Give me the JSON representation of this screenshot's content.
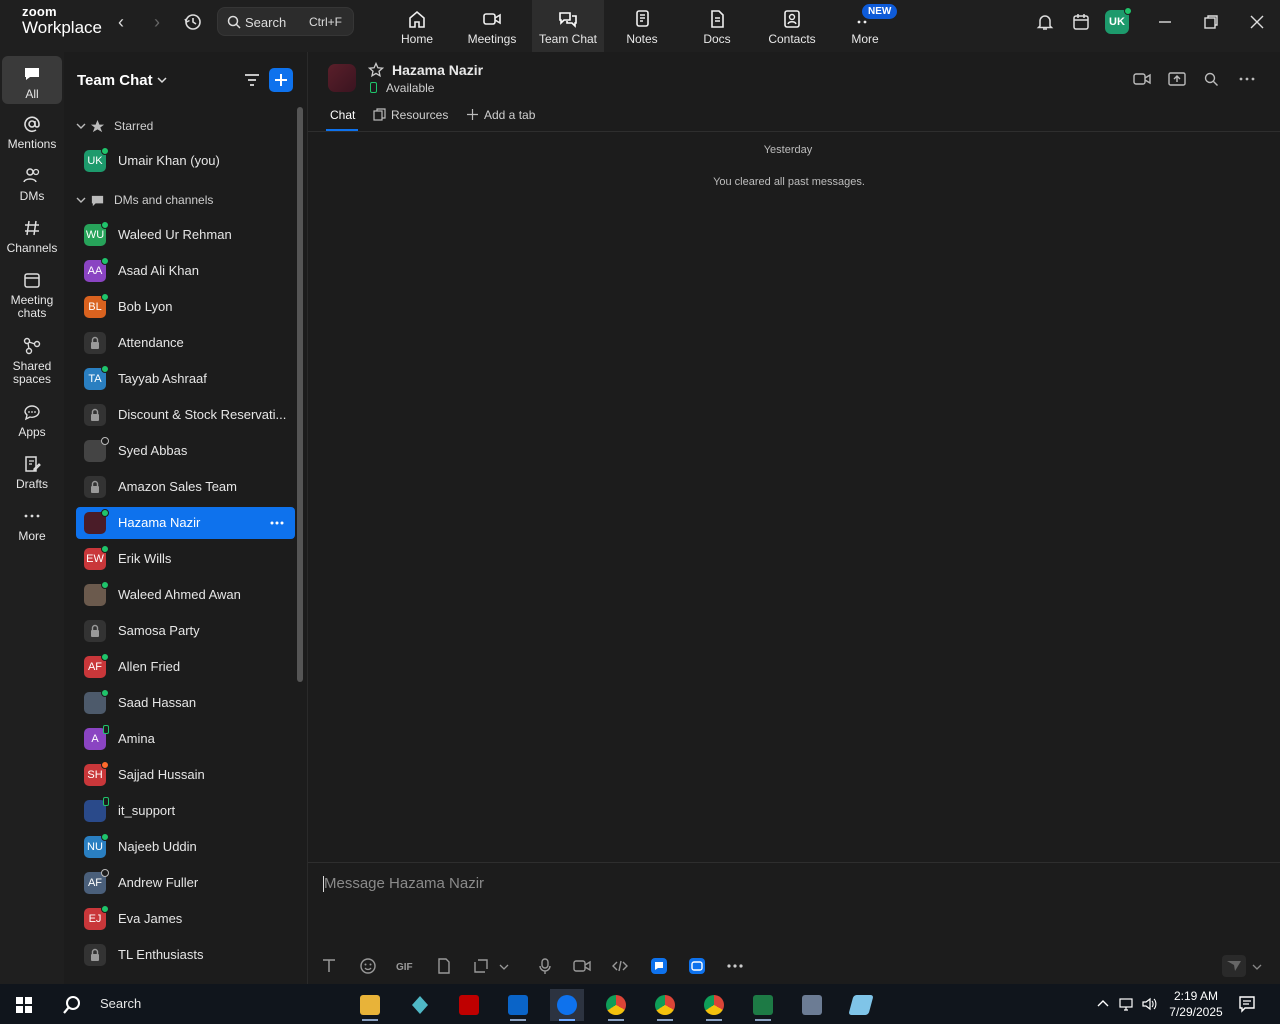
{
  "app": {
    "brand_line1": "zoom",
    "brand_line2": "Workplace"
  },
  "search": {
    "placeholder": "Search",
    "shortcut": "Ctrl+F"
  },
  "top_tabs": [
    {
      "label": "Home",
      "icon": "home-icon"
    },
    {
      "label": "Meetings",
      "icon": "video-camera-icon"
    },
    {
      "label": "Team Chat",
      "icon": "chat-bubbles-icon",
      "active": true
    },
    {
      "label": "Notes",
      "icon": "notes-icon"
    },
    {
      "label": "Docs",
      "icon": "docs-icon"
    },
    {
      "label": "Contacts",
      "icon": "contacts-icon"
    },
    {
      "label": "More",
      "icon": "more-dots-icon"
    }
  ],
  "new_badge": "NEW",
  "user_initials": "UK",
  "rail": [
    {
      "label": "All",
      "icon": "chat-icon",
      "active": true
    },
    {
      "label": "Mentions",
      "icon": "at-icon"
    },
    {
      "label": "DMs",
      "icon": "people-icon"
    },
    {
      "label": "Channels",
      "icon": "hash-icon"
    },
    {
      "label": "Meeting chats",
      "icon": "calendar-icon"
    },
    {
      "label": "Shared spaces",
      "icon": "shared-spaces-icon"
    },
    {
      "label": "Apps",
      "icon": "apps-icon"
    },
    {
      "label": "Drafts",
      "icon": "drafts-icon"
    },
    {
      "label": "More",
      "icon": "ellipsis-icon"
    }
  ],
  "sidebar": {
    "title": "Team Chat",
    "starred_label": "Starred",
    "starred": [
      {
        "name": "Umair Khan (you)",
        "initials": "UK",
        "color": "#1d9a6c",
        "presence": "online"
      }
    ],
    "dms_label": "DMs and channels",
    "items": [
      {
        "name": "Waleed Ur Rehman",
        "initials": "WU",
        "color": "#27a35a",
        "presence": "online"
      },
      {
        "name": "Asad Ali Khan",
        "initials": "AA",
        "color": "#8a44c2",
        "presence": "online"
      },
      {
        "name": "Bob Lyon",
        "initials": "BL",
        "color": "#d9621f",
        "presence": "online"
      },
      {
        "name": "Attendance",
        "type": "channel"
      },
      {
        "name": "Tayyab Ashraaf",
        "initials": "TA",
        "color": "#2a7fc1",
        "presence": "online"
      },
      {
        "name": "Discount & Stock Reservati...",
        "type": "channel"
      },
      {
        "name": "Syed Abbas",
        "initials": "",
        "color": "#444444",
        "presence": "away",
        "photo": true
      },
      {
        "name": "Amazon Sales Team",
        "type": "channel"
      },
      {
        "name": "Hazama Nazir",
        "initials": "",
        "color": "#4a1c28",
        "presence": "online",
        "active": true
      },
      {
        "name": "Erik Wills",
        "initials": "EW",
        "color": "#c9373a",
        "presence": "online"
      },
      {
        "name": "Waleed Ahmed Awan",
        "initials": "",
        "color": "#6b5a4d",
        "presence": "online",
        "photo": true
      },
      {
        "name": "Samosa Party",
        "type": "channel"
      },
      {
        "name": "Allen Fried",
        "initials": "AF",
        "color": "#c9373a",
        "presence": "online"
      },
      {
        "name": "Saad Hassan",
        "initials": "",
        "color": "#4d5a6b",
        "presence": "online",
        "photo": true
      },
      {
        "name": "Amina",
        "initials": "A",
        "color": "#8a44c2",
        "presence": "mobile"
      },
      {
        "name": "Sajjad Hussain",
        "initials": "SH",
        "color": "#c9373a",
        "presence": "busy"
      },
      {
        "name": "it_support",
        "initials": "",
        "color": "#2a4a8a",
        "presence": "mobile",
        "photo": true
      },
      {
        "name": "Najeeb Uddin",
        "initials": "NU",
        "color": "#2a7fc1",
        "presence": "online"
      },
      {
        "name": "Andrew Fuller",
        "initials": "AF",
        "color": "#4a5f7a",
        "presence": "away"
      },
      {
        "name": "Eva James",
        "initials": "EJ",
        "color": "#c9373a",
        "presence": "online"
      },
      {
        "name": "TL Enthusiasts",
        "type": "channel"
      }
    ]
  },
  "chat": {
    "contact_name": "Hazama Nazir",
    "status": "Available",
    "tabs": [
      {
        "label": "Chat",
        "active": true
      },
      {
        "label": "Resources"
      },
      {
        "label": "Add a tab"
      }
    ],
    "date_divider": "Yesterday",
    "system_message": "You cleared all past messages.",
    "composer_placeholder": "Message Hazama Nazir",
    "toolbar": [
      {
        "icon": "text-format-icon"
      },
      {
        "icon": "emoji-icon"
      },
      {
        "icon": "gif-icon",
        "label": "GIF"
      },
      {
        "icon": "file-icon"
      },
      {
        "icon": "screenshot-icon"
      },
      {
        "icon": "screenshot-dropdown-icon"
      },
      {
        "icon": "microphone-icon"
      },
      {
        "icon": "video-message-icon"
      },
      {
        "icon": "code-snippet-icon"
      },
      {
        "icon": "app-blue-icon"
      },
      {
        "icon": "app-zoom-icon"
      },
      {
        "icon": "more-options-icon"
      }
    ]
  },
  "taskbar": {
    "search_label": "Search",
    "time": "2:19 AM",
    "date": "7/29/2025",
    "apps": [
      "file-explorer",
      "app-diamond",
      "filezilla",
      "outlook",
      "zoom",
      "chrome",
      "chrome",
      "chrome",
      "excel",
      "calculator",
      "app-notes"
    ]
  }
}
